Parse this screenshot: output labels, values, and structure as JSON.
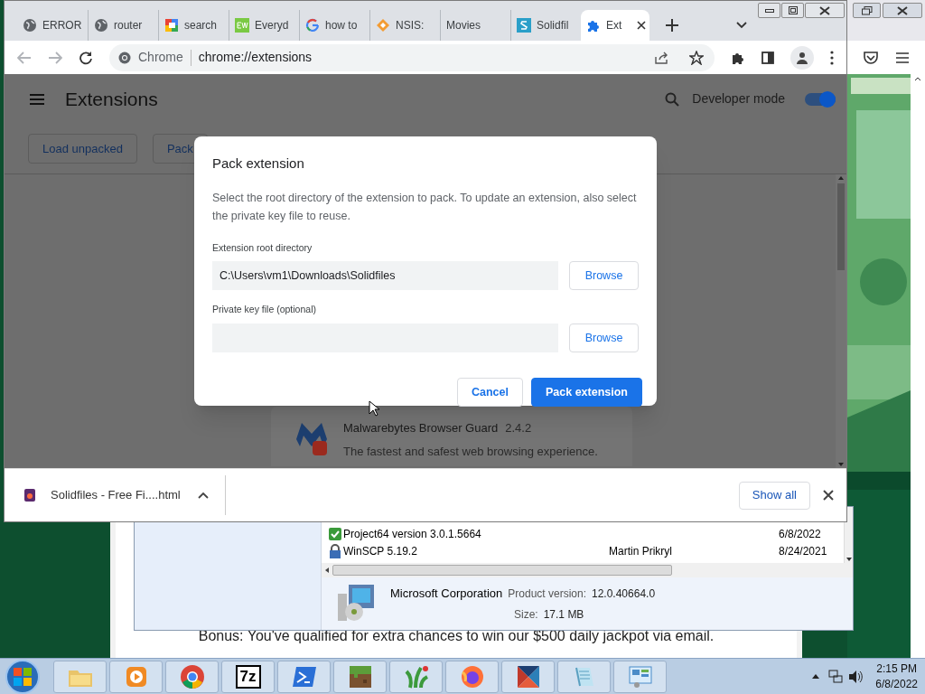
{
  "chrome": {
    "tabs": [
      {
        "title": "ERROR",
        "kind": "globe",
        "selected": false
      },
      {
        "title": "router",
        "kind": "globe",
        "selected": false
      },
      {
        "title": "search",
        "kind": "colorful",
        "selected": false
      },
      {
        "title": "Everyd",
        "kind": "ew",
        "selected": false
      },
      {
        "title": "how to",
        "kind": "google",
        "selected": false
      },
      {
        "title": "NSIS:",
        "kind": "diamond",
        "selected": false
      },
      {
        "title": "Movies",
        "kind": "plain",
        "selected": false
      },
      {
        "title": "Solidfil",
        "kind": "solidfiles",
        "selected": false
      },
      {
        "title": "Ext",
        "kind": "puzzle",
        "selected": true
      }
    ],
    "address": {
      "site_label": "Chrome",
      "url": "chrome://extensions"
    },
    "extensions_page": {
      "title": "Extensions",
      "developer_mode": {
        "label": "Developer mode",
        "on": true
      },
      "buttons": [
        "Load unpacked",
        "Pack"
      ],
      "extension": {
        "name": "Malwarebytes Browser Guard",
        "version": "2.4.2",
        "description": "The fastest and safest web browsing experience."
      }
    },
    "dialog": {
      "title": "Pack extension",
      "description": "Select the root directory of the extension to pack. To update an extension, also select the private key file to reuse.",
      "fields": [
        {
          "label": "Extension root directory",
          "value": "C:\\Users\\vm1\\Downloads\\Solidfiles",
          "button": "Browse"
        },
        {
          "label": "Private key file (optional)",
          "button": "Browse"
        }
      ],
      "buttons": [
        {
          "label": "Cancel",
          "kind": "secondary"
        },
        {
          "label": "Pack extension",
          "kind": "primary"
        }
      ]
    },
    "download_bar": {
      "file": "Solidfiles - Free Fi....html",
      "show_all": "Show all"
    }
  },
  "programs_window": {
    "rows": [
      {
        "name": "Project64 version 3.0.1.5664",
        "date": "6/8/2022",
        "kind": "check"
      },
      {
        "name": "WinSCP 5.19.2",
        "publisher": "Martin Prikryl",
        "date": "8/24/2021",
        "kind": "lock"
      }
    ],
    "details": {
      "publisher": "Microsoft Corporation",
      "version_label": "Product version:",
      "version": "12.0.40664.0",
      "size_label": "Size:",
      "size": "17.1 MB"
    }
  },
  "web_page": {
    "text": "Bonus: You've qualified for extra chances to win our $500 daily jackpot via email."
  },
  "taskbar": {
    "apps": [
      {
        "kind": "folder"
      },
      {
        "kind": "media"
      },
      {
        "kind": "chrome"
      },
      {
        "kind": "sevenzip",
        "label": "7z"
      },
      {
        "kind": "powershell"
      },
      {
        "kind": "minecraft"
      },
      {
        "kind": "plant"
      },
      {
        "kind": "firefox"
      },
      {
        "kind": "triangles"
      },
      {
        "kind": "notepad"
      },
      {
        "kind": "panel"
      }
    ],
    "clock": {
      "time": "2:15 PM",
      "date": "6/8/2022"
    }
  }
}
